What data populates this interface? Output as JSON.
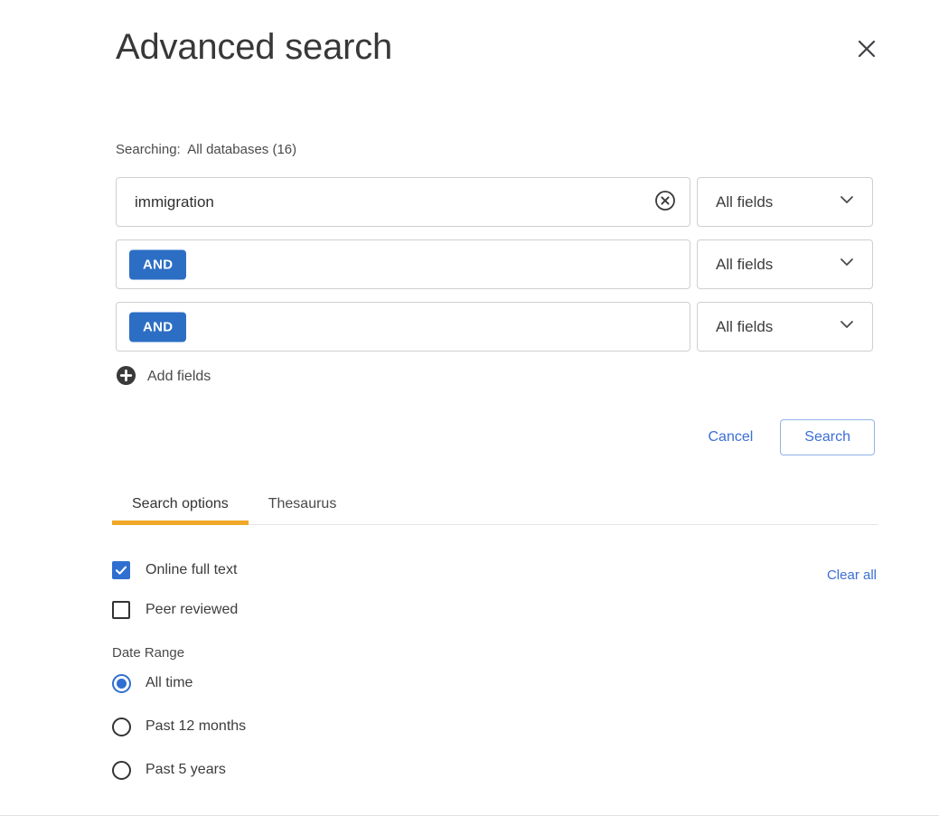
{
  "dialog": {
    "title": "Advanced search",
    "close_icon": "close-icon"
  },
  "searching": {
    "label": "Searching:",
    "value": "All databases (16)"
  },
  "query_rows": [
    {
      "operator": null,
      "value": "immigration",
      "placeholder": "",
      "clear_icon": "clear-circle-icon",
      "field": "All fields"
    },
    {
      "operator": "AND",
      "value": "",
      "placeholder": "",
      "clear_icon": null,
      "field": "All fields"
    },
    {
      "operator": "AND",
      "value": "",
      "placeholder": "",
      "clear_icon": null,
      "field": "All fields"
    }
  ],
  "add_fields": {
    "label": "Add fields",
    "icon": "plus-circle-icon"
  },
  "actions": {
    "cancel_label": "Cancel",
    "search_label": "Search"
  },
  "tabs": [
    {
      "label": "Search options",
      "active": true
    },
    {
      "label": "Thesaurus",
      "active": false
    }
  ],
  "options": {
    "clear_all_label": "Clear all",
    "checkboxes": [
      {
        "label": "Online full text",
        "checked": true
      },
      {
        "label": "Peer reviewed",
        "checked": false
      }
    ],
    "date_range": {
      "title": "Date Range",
      "options": [
        {
          "label": "All time",
          "selected": true
        },
        {
          "label": "Past 12 months",
          "selected": false
        },
        {
          "label": "Past 5 years",
          "selected": false
        }
      ]
    }
  },
  "colors": {
    "operator_blue": "#2c6ec4",
    "link_blue": "#3b6fd4",
    "accent_amber": "#efa827",
    "checkbox_blue": "#2f6fd0"
  }
}
